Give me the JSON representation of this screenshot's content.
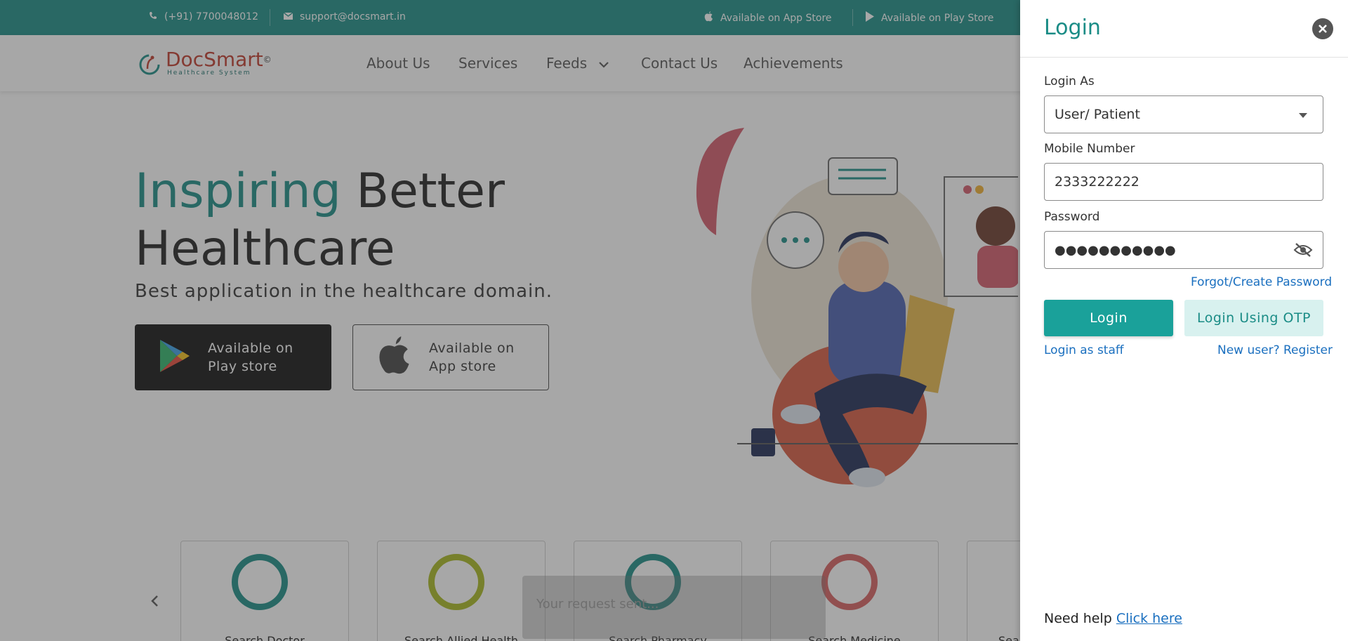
{
  "topbar": {
    "phone": "(+91) 7700048012",
    "email": "support@docsmart.in",
    "app_store": "Available on App Store",
    "play_store": "Available on Play Store"
  },
  "logo": {
    "name": "DocSmart",
    "mark": "©",
    "tagline": "Healthcare System"
  },
  "nav": {
    "items": [
      "About Us",
      "Services",
      "Feeds",
      "Contact Us",
      "Achievements"
    ]
  },
  "hero": {
    "title_accent": "Inspiring",
    "title_rest": "Better",
    "title_line2": "Healthcare",
    "subtitle": "Best application in the healthcare domain.",
    "play_line1": "Available on",
    "play_line2": "Play store",
    "apple_line1": "Available on",
    "apple_line2": "App store"
  },
  "cards": [
    {
      "label": "Search Doctor",
      "color": "#1a8c86"
    },
    {
      "label": "Search Allied Health",
      "color": "#a8b820"
    },
    {
      "label": "Search Pharmacy",
      "color": "#1a8c86"
    },
    {
      "label": "Search Medicine",
      "color": "#d86060"
    },
    {
      "label": "Sea",
      "color": "#1a8c86"
    }
  ],
  "toast": {
    "text": "Your request sent..."
  },
  "login": {
    "title": "Login",
    "login_as_label": "Login As",
    "login_as_value": "User/ Patient",
    "mobile_label": "Mobile Number",
    "mobile_value": "2333222222",
    "password_label": "Password",
    "password_value": "●●●●●●●●●●●",
    "forgot": "Forgot/Create Password",
    "login_button": "Login",
    "otp_button": "Login Using OTP",
    "staff_link": "Login as staff",
    "register_link": "New user? Register",
    "need_help": "Need help",
    "click_here": "Click here"
  },
  "colors": {
    "brand": "#1a8c86",
    "link": "#1a6fbf",
    "logo_red": "#c0392b"
  }
}
